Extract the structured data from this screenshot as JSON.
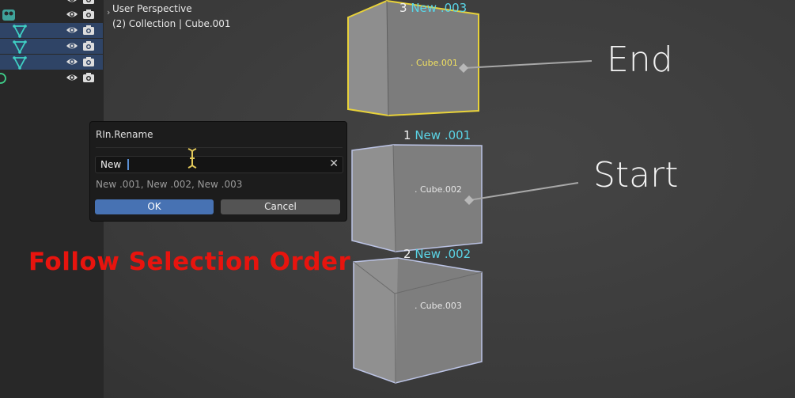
{
  "outliner": {
    "rows": [
      {
        "type": "camera",
        "selected": false
      },
      {
        "type": "mesh",
        "selected": true
      },
      {
        "type": "mesh",
        "selected": true
      },
      {
        "type": "mesh",
        "selected": true
      },
      {
        "type": "light",
        "selected": false
      }
    ],
    "colors": {
      "selected_row": "#2f4466",
      "mesh_icon": "#3fd0c4"
    }
  },
  "viewport": {
    "perspective": "User Perspective",
    "collection_line": "(2) Collection | Cube.001"
  },
  "cubes": [
    {
      "order": "3",
      "new_name": "New .003",
      "object_name": "Cube.001",
      "state": "active",
      "outline_color": "#e8d23a"
    },
    {
      "order": "1",
      "new_name": "New .001",
      "object_name": "Cube.002",
      "state": "selected",
      "outline_color": "#bcc4e6"
    },
    {
      "order": "2",
      "new_name": "New .002",
      "object_name": "Cube.003",
      "state": "selected",
      "outline_color": "#bcc4e6"
    }
  ],
  "annotations": {
    "end": "End",
    "start": "Start",
    "caption": "Follow Selection Order",
    "caption_color": "#e8140e"
  },
  "dialog": {
    "title": "RIn.Rename",
    "field_value": "New",
    "preview": "New .001, New .002, New .003",
    "ok_label": "OK",
    "cancel_label": "Cancel"
  }
}
